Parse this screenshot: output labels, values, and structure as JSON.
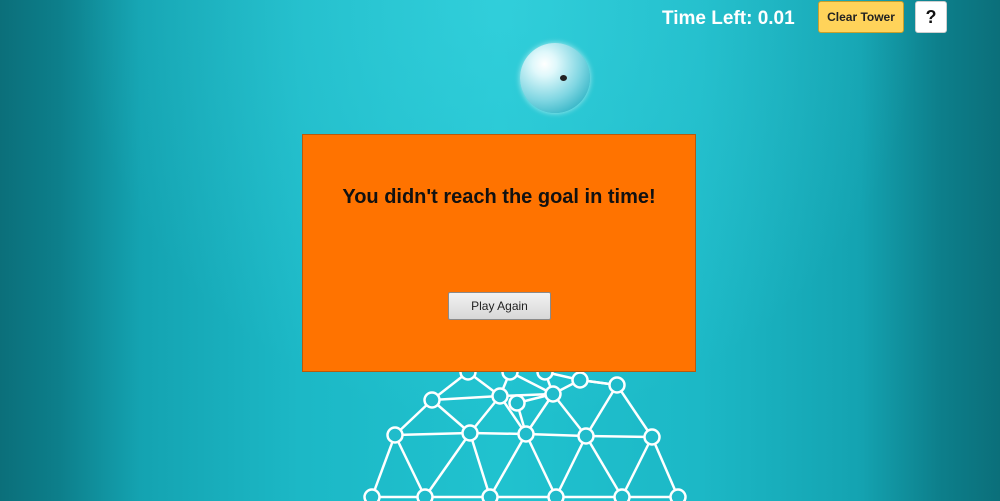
{
  "hud": {
    "time_left_label": "Time Left: 0.01",
    "clear_tower_label": "Clear Tower",
    "help_label": "?"
  },
  "dialog": {
    "message": "You didn't reach the goal in time!",
    "play_again_label": "Play Again"
  },
  "colors": {
    "dialog_bg": "#ff7300",
    "clear_button_bg": "#ffd35a",
    "background": "#1cb8c6"
  }
}
